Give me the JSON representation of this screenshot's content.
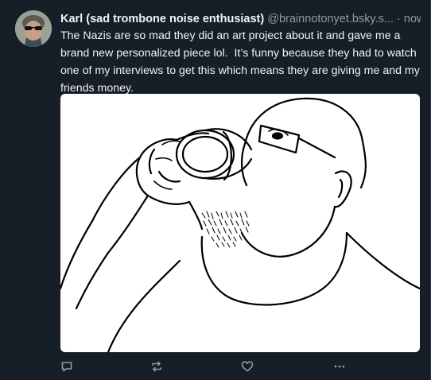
{
  "post": {
    "display_name": "Karl (sad trombone noise enthusiast)",
    "handle": "@brainnotonyet.bsky.s...",
    "separator": "·",
    "time": "now",
    "text": "The Nazis are so mad they did an art project about it and gave me a brand new personalized piece lol.  It’s funny because they had to watch one of my interviews to get this which means they are giving me and my friends money."
  },
  "actions": {
    "reply_icon": "reply-icon",
    "repost_icon": "repost-icon",
    "like_icon": "heart-icon",
    "more_icon": "more-icon"
  },
  "colors": {
    "background": "#161e27",
    "text": "#f1f3f5",
    "muted": "#8d9aa8"
  }
}
